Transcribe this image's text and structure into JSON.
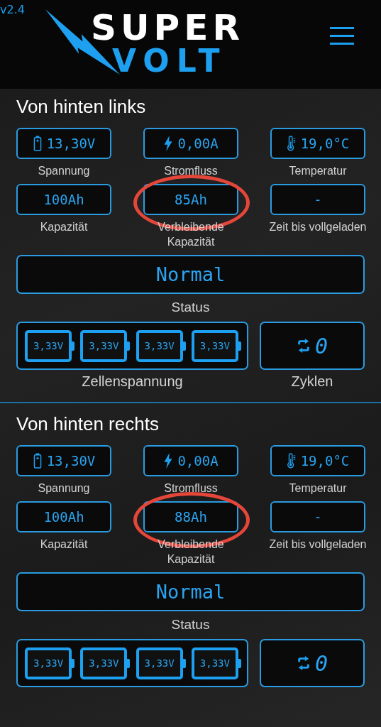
{
  "version": "v2.4",
  "logo": {
    "line_1": "SUPER",
    "line_2": "VOLT"
  },
  "sections": [
    {
      "title": "Von hinten links",
      "metrics": [
        {
          "kind": "battery",
          "value": "13,30V",
          "label": "Spannung",
          "circled": false
        },
        {
          "kind": "current",
          "value": "0,00A",
          "label": "Stromfluss",
          "circled": false
        },
        {
          "kind": "temperature",
          "value": "19,0°C",
          "label": "Temperatur",
          "circled": false
        },
        {
          "kind": "plain",
          "value": "100Ah",
          "label": "Kapazität",
          "circled": false
        },
        {
          "kind": "plain",
          "value": "85Ah",
          "label": "Verbleibende Kapazität",
          "circled": true
        },
        {
          "kind": "plain",
          "value": "-",
          "label": "Zeit bis vollgeladen",
          "circled": false
        }
      ],
      "status": {
        "value": "Normal",
        "label": "Status"
      },
      "cells": {
        "values": [
          "3,33V",
          "3,33V",
          "3,33V",
          "3,33V"
        ],
        "label": "Zellenspannung"
      },
      "cycles": {
        "value": "0",
        "label": "Zyklen"
      }
    },
    {
      "title": "Von hinten rechts",
      "metrics": [
        {
          "kind": "battery",
          "value": "13,30V",
          "label": "Spannung",
          "circled": false
        },
        {
          "kind": "current",
          "value": "0,00A",
          "label": "Stromfluss",
          "circled": false
        },
        {
          "kind": "temperature",
          "value": "19,0°C",
          "label": "Temperatur",
          "circled": false
        },
        {
          "kind": "plain",
          "value": "100Ah",
          "label": "Kapazität",
          "circled": false
        },
        {
          "kind": "plain",
          "value": "88Ah",
          "label": "Verbleibende Kapazität",
          "circled": true
        },
        {
          "kind": "plain",
          "value": "-",
          "label": "Zeit bis vollgeladen",
          "circled": false
        }
      ],
      "status": {
        "value": "Normal",
        "label": "Status"
      },
      "cells": {
        "values": [
          "3,33V",
          "3,33V",
          "3,33V",
          "3,33V"
        ]
      },
      "cycles": {
        "value": "0"
      }
    }
  ]
}
